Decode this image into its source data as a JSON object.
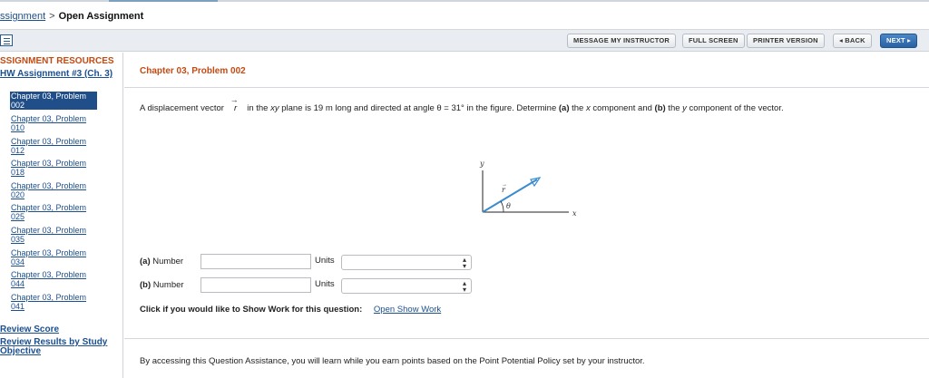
{
  "breadcrumb": {
    "parent": "ssignment",
    "separator": ">",
    "current": "Open Assignment"
  },
  "toolbar": {
    "message": "MESSAGE MY INSTRUCTOR",
    "fullscreen": "FULL SCREEN",
    "printer": "PRINTER VERSION",
    "back": "◂ BACK",
    "next": "NEXT ▸"
  },
  "sidebar": {
    "title": "SSIGNMENT RESOURCES",
    "assignment": "HW Assignment #3 (Ch. 3)",
    "problems": [
      {
        "line1": "Chapter 03, Problem",
        "line2": "002",
        "active": true
      },
      {
        "line1": "Chapter 03, Problem",
        "line2": "010"
      },
      {
        "line1": "Chapter 03, Problem",
        "line2": "012"
      },
      {
        "line1": "Chapter 03, Problem",
        "line2": "018"
      },
      {
        "line1": "Chapter 03, Problem",
        "line2": "020"
      },
      {
        "line1": "Chapter 03, Problem",
        "line2": "025"
      },
      {
        "line1": "Chapter 03, Problem",
        "line2": "035"
      },
      {
        "line1": "Chapter 03, Problem",
        "line2": "034"
      },
      {
        "line1": "Chapter 03, Problem",
        "line2": "044"
      },
      {
        "line1": "Chapter 03, Problem",
        "line2": "041"
      }
    ],
    "review_score": "Review Score",
    "review_results": "Review Results by Study Objective"
  },
  "problem": {
    "title": "Chapter 03, Problem 002",
    "text_before": "A displacement vector",
    "vector_symbol": "r",
    "vector_arrow": "→",
    "text_after_1": " in the ",
    "xy": "xy",
    "text_after_2": " plane is 19 m long and directed at angle θ = 31° in the figure. Determine ",
    "part_a": "(a)",
    "text_after_3": " the ",
    "x": "x",
    "text_after_4": " component and ",
    "part_b": "(b)",
    "text_after_5": " the ",
    "y": "y",
    "text_after_6": " component of the vector."
  },
  "figure": {
    "y_label": "y",
    "x_label": "x",
    "r_label": "r",
    "theta_label": "θ",
    "accent": "#3a8bd0"
  },
  "answers": [
    {
      "part": "(a)",
      "label": "Number",
      "units_label": "Units",
      "value": "",
      "units_value": ""
    },
    {
      "part": "(b)",
      "label": "Number",
      "units_label": "Units",
      "value": "",
      "units_value": ""
    }
  ],
  "show_work": {
    "prompt": "Click if you would like to Show Work for this question:",
    "link": "Open Show Work"
  },
  "assistance": "By accessing this Question Assistance, you will learn while you earn points based on the Point Potential Policy set by your instructor.",
  "colors": {
    "link": "#1b4f8f",
    "heading": "#c44a12",
    "active": "#1f4e89"
  }
}
